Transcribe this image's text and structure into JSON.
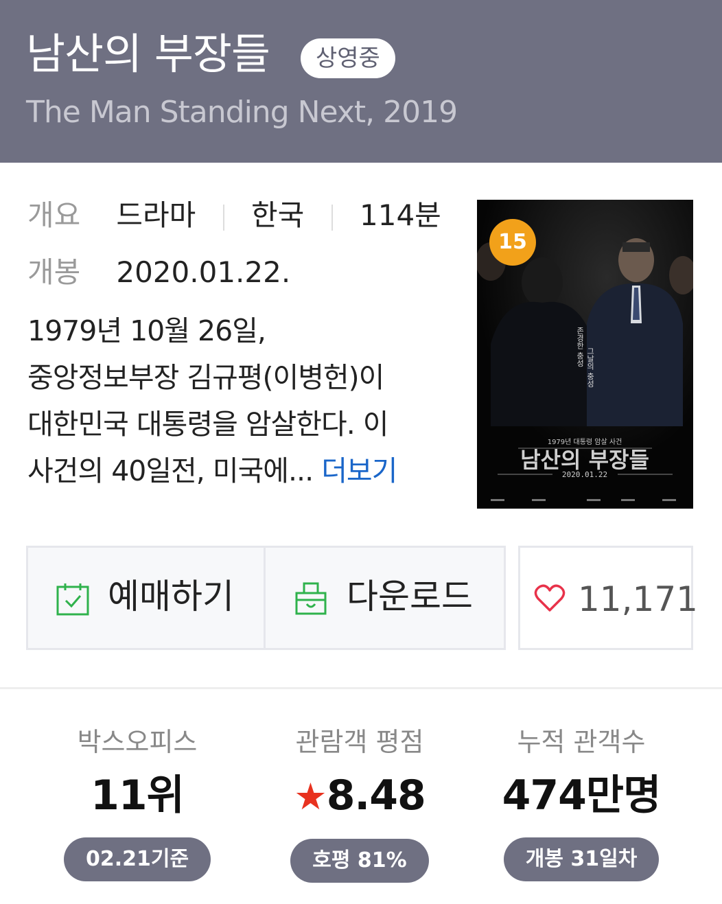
{
  "header": {
    "title": "남산의 부장들",
    "status_badge": "상영중",
    "subtitle": "The Man Standing Next, 2019"
  },
  "info": {
    "overview_label": "개요",
    "genre": "드라마",
    "country": "한국",
    "runtime": "114분",
    "release_label": "개봉",
    "release_date": "2020.01.22."
  },
  "synopsis": {
    "lines": [
      "1979년 10월 26일,",
      "중앙정보부장 김규평(이병헌)이",
      "대한민국 대통령을 암살한다. 이",
      "사건의 40일전, 미국에..."
    ],
    "more_label": "더보기"
  },
  "poster": {
    "age_rating": "15",
    "tagline_1": "존경한 충성",
    "tagline_2": "그날의 충성",
    "caption": "1979년 대통령 암살 사건",
    "title": "남산의 부장들",
    "date": "2020.01.22"
  },
  "actions": {
    "reserve_label": "예매하기",
    "download_label": "다운로드",
    "like_count": "11,171"
  },
  "stats": [
    {
      "label": "박스오피스",
      "value": "11위",
      "pill": "02.21기준"
    },
    {
      "label": "관람객 평점",
      "star": "★",
      "value": "8.48",
      "pill": "호평 81%"
    },
    {
      "label": "누적 관객수",
      "value": "474만명",
      "pill": "개봉 31일차"
    }
  ],
  "colors": {
    "header_bg": "#6f7082",
    "link": "#1a66c9",
    "age_badge": "#f2a11a",
    "star": "#e8321f",
    "icon_green": "#2fb24c",
    "heart": "#e8324a"
  }
}
